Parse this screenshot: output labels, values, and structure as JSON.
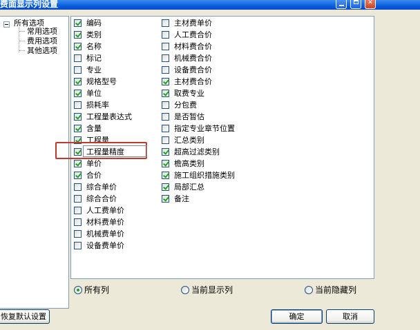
{
  "window": {
    "title": "费面显示列设置"
  },
  "tree": {
    "root": "所有选项",
    "children": [
      "常用选项",
      "费用选项",
      "其他选项"
    ]
  },
  "columns_left": [
    {
      "label": "编码",
      "checked": true
    },
    {
      "label": "类别",
      "checked": true
    },
    {
      "label": "名称",
      "checked": true
    },
    {
      "label": "标记",
      "checked": false
    },
    {
      "label": "专业",
      "checked": false
    },
    {
      "label": "规格型号",
      "checked": true
    },
    {
      "label": "单位",
      "checked": true
    },
    {
      "label": "损耗率",
      "checked": false
    },
    {
      "label": "工程量表达式",
      "checked": true
    },
    {
      "label": "含量",
      "checked": true
    },
    {
      "label": "工程量",
      "checked": true
    },
    {
      "label": "工程量精度",
      "checked": true
    },
    {
      "label": "单价",
      "checked": true
    },
    {
      "label": "合价",
      "checked": true
    },
    {
      "label": "综合单价",
      "checked": false
    },
    {
      "label": "综合合价",
      "checked": false
    },
    {
      "label": "人工费单价",
      "checked": false
    },
    {
      "label": "材料费单价",
      "checked": false
    },
    {
      "label": "机械费单价",
      "checked": false
    },
    {
      "label": "设备费单价",
      "checked": false
    }
  ],
  "columns_right": [
    {
      "label": "主材费单价",
      "checked": false
    },
    {
      "label": "人工费合价",
      "checked": false
    },
    {
      "label": "材料费合价",
      "checked": false
    },
    {
      "label": "机械费合价",
      "checked": false
    },
    {
      "label": "设备费合价",
      "checked": false
    },
    {
      "label": "主材费合价",
      "checked": true
    },
    {
      "label": "取费专业",
      "checked": true
    },
    {
      "label": "分包费",
      "checked": false
    },
    {
      "label": "是否暂估",
      "checked": false
    },
    {
      "label": "指定专业章节位置",
      "checked": false
    },
    {
      "label": "汇总类别",
      "checked": false
    },
    {
      "label": "超高过滤类别",
      "checked": true
    },
    {
      "label": "檐高类别",
      "checked": true
    },
    {
      "label": "施工组织措施类别",
      "checked": true
    },
    {
      "label": "局部汇总",
      "checked": true
    },
    {
      "label": "备注",
      "checked": true
    }
  ],
  "filter": {
    "options": [
      "所有列",
      "当前显示列",
      "当前隐藏列"
    ],
    "selected": "所有列"
  },
  "buttons": {
    "reset": "恢复默认设置",
    "ok": "确定",
    "cancel": "取消"
  },
  "highlight_item": "工程量精度",
  "colors": {
    "highlight": "#C0392B",
    "check": "#21A121",
    "title_bar": "#0A5FE0"
  }
}
